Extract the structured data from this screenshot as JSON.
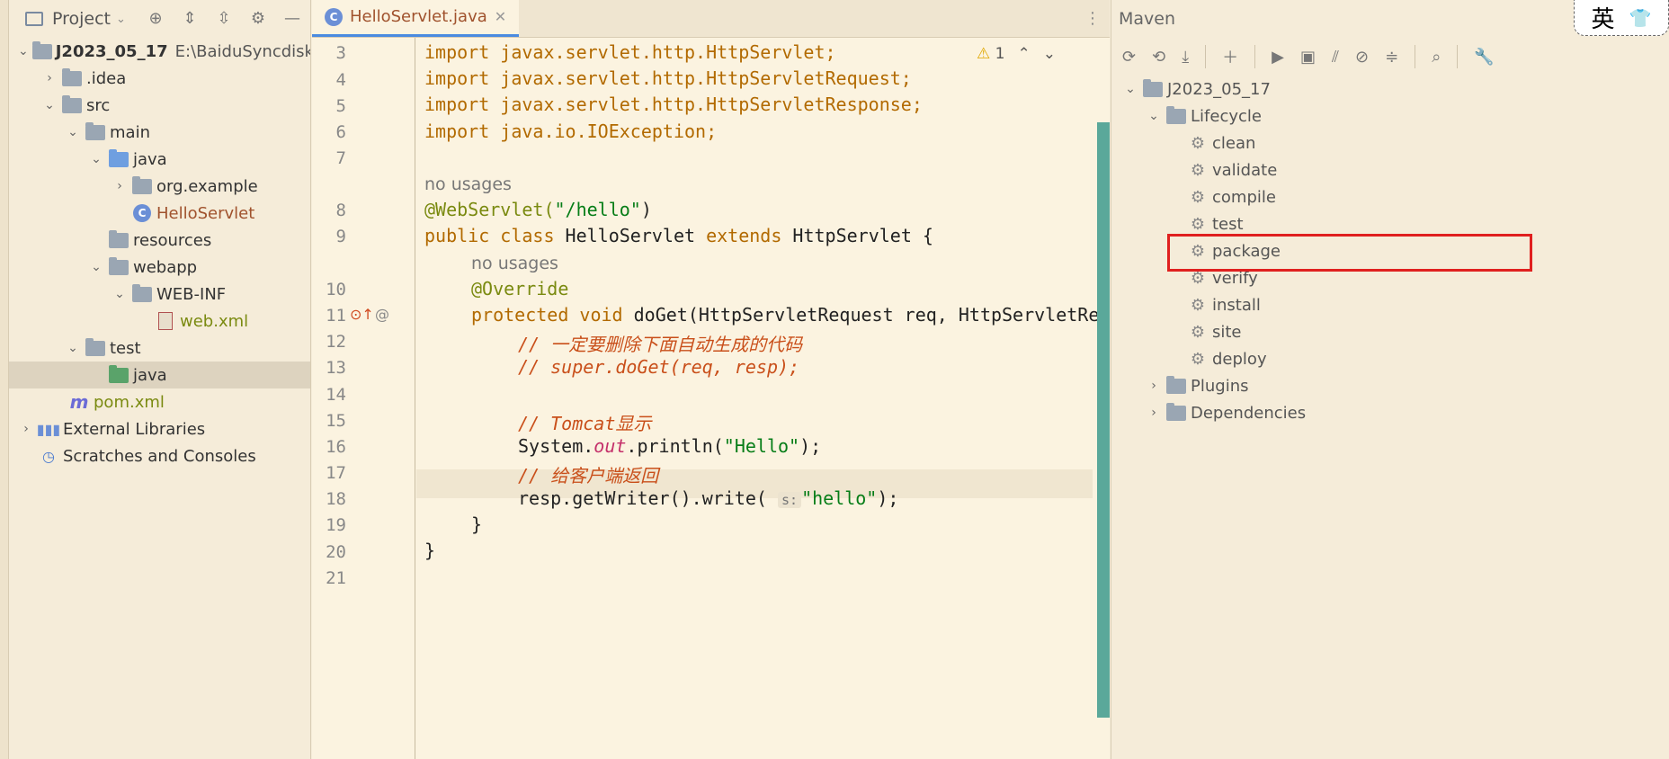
{
  "project": {
    "title": "Project",
    "tree": [
      {
        "label": "J2023_05_17",
        "extra": "E:\\BaiduSyncdisk\\",
        "arrow": "⌄",
        "icon": "module-folder-icon"
      },
      {
        "label": ".idea",
        "arrow": "›",
        "icon": "folder-icon"
      },
      {
        "label": "src",
        "arrow": "⌄",
        "icon": "folder-icon"
      },
      {
        "label": "main",
        "arrow": "⌄",
        "icon": "folder-icon"
      },
      {
        "label": "java",
        "arrow": "⌄",
        "icon": "source-folder-icon"
      },
      {
        "label": "org.example",
        "arrow": "›",
        "icon": "package-icon"
      },
      {
        "label": "HelloServlet",
        "arrow": "",
        "icon": "class-icon"
      },
      {
        "label": "resources",
        "arrow": "",
        "icon": "resources-folder-icon"
      },
      {
        "label": "webapp",
        "arrow": "⌄",
        "icon": "folder-icon"
      },
      {
        "label": "WEB-INF",
        "arrow": "⌄",
        "icon": "folder-icon"
      },
      {
        "label": "web.xml",
        "arrow": "",
        "icon": "xml-file-icon"
      },
      {
        "label": "test",
        "arrow": "⌄",
        "icon": "folder-icon"
      },
      {
        "label": "java",
        "arrow": "",
        "icon": "test-source-folder-icon"
      },
      {
        "label": "pom.xml",
        "arrow": "",
        "icon": "maven-file-icon"
      },
      {
        "label": "External Libraries",
        "arrow": "›",
        "icon": "libraries-icon"
      },
      {
        "label": "Scratches and Consoles",
        "arrow": "",
        "icon": "scratches-icon"
      }
    ]
  },
  "editor": {
    "tab": "HelloServlet.java",
    "warning_count": "1",
    "line_numbers": [
      "3",
      "4",
      "5",
      "6",
      "7",
      "8",
      "9",
      "10",
      "11",
      "12",
      "13",
      "14",
      "15",
      "16",
      "17",
      "18",
      "19",
      "20",
      "21"
    ],
    "hints": {
      "usages1": "no usages",
      "usages2": "no usages"
    },
    "code": {
      "l3": "import javax.servlet.http.HttpServlet;",
      "l4": "import javax.servlet.http.HttpServletRequest;",
      "l5": "import javax.servlet.http.HttpServletResponse;",
      "l6": "import java.io.IOException;",
      "l8a": "@WebServlet(",
      "l8b": "\"/hello\"",
      "l8c": ")",
      "l9a": "public class ",
      "l9b": "HelloServlet ",
      "l9c": "extends ",
      "l9d": "HttpServlet {",
      "l10": "@Override",
      "l11a": "protected void ",
      "l11b": "doGet(HttpServletRequest req, HttpServletRe",
      "l12": "// 一定要删除下面自动生成的代码",
      "l13": "// super.doGet(req, resp);",
      "l15": "// Tomcat显示",
      "l16a": "System.",
      "l16b": "out",
      "l16c": ".println(",
      "l16d": "\"Hello\"",
      "l16e": ");",
      "l17": "// 给客户端返回",
      "l18a": "resp.getWriter().write(",
      "l18p": "s:",
      "l18b": "\"hello\"",
      "l18c": ");",
      "l19": "}",
      "l20": "}"
    }
  },
  "maven": {
    "title": "Maven",
    "project": "J2023_05_17",
    "lifecycle": "Lifecycle",
    "phases": [
      "clean",
      "validate",
      "compile",
      "test",
      "package",
      "verify",
      "install",
      "site",
      "deploy"
    ],
    "highlighted": "package",
    "plugins": "Plugins",
    "dependencies": "Dependencies"
  },
  "ime": {
    "lang": "英",
    "icon": "shirt-icon"
  }
}
